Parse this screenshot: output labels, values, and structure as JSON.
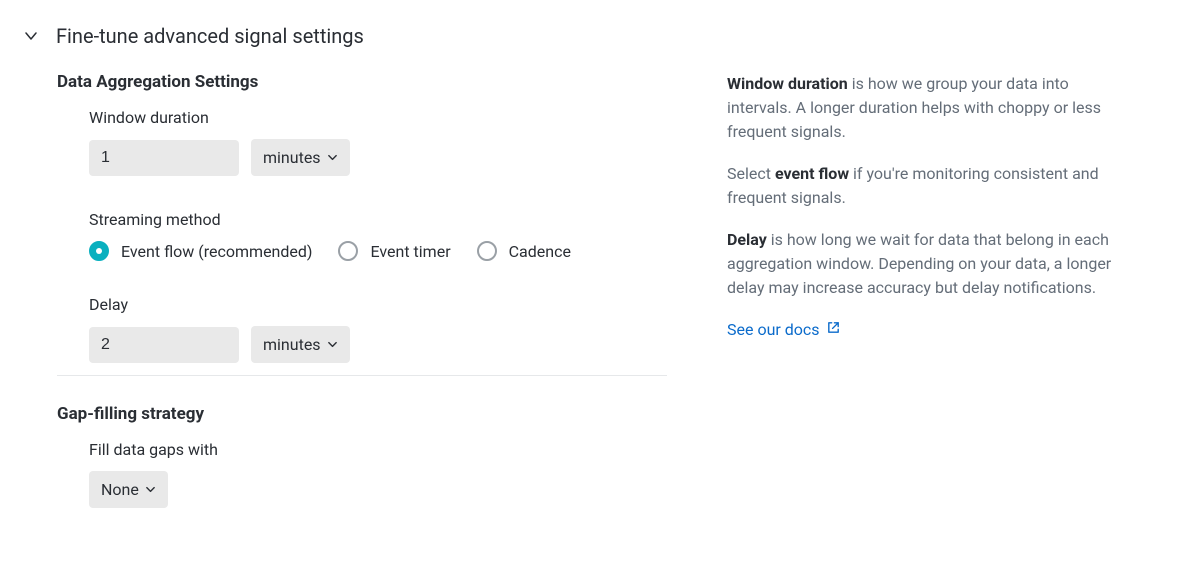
{
  "header": {
    "title": "Fine-tune advanced signal settings"
  },
  "sections": {
    "aggregation": {
      "title": "Data Aggregation Settings",
      "window_duration": {
        "label": "Window duration",
        "value": "1",
        "unit": "minutes"
      },
      "streaming": {
        "label": "Streaming method",
        "options": {
          "event_flow": "Event flow (recommended)",
          "event_timer": "Event timer",
          "cadence": "Cadence"
        },
        "selected": "event_flow"
      },
      "delay": {
        "label": "Delay",
        "value": "2",
        "unit": "minutes"
      }
    },
    "gap": {
      "title": "Gap-filling strategy",
      "fill": {
        "label": "Fill data gaps with",
        "value": "None"
      }
    }
  },
  "help": {
    "p1_bold": "Window duration",
    "p1_rest": " is how we group your data into intervals. A longer duration helps with choppy or less frequent signals.",
    "p2_pre": "Select ",
    "p2_bold": "event flow",
    "p2_rest": " if you're monitoring consistent and frequent signals.",
    "p3_bold": "Delay",
    "p3_rest": " is how long we wait for data that belong in each aggregation window. Depending on your data, a longer delay may increase accuracy but delay notifications.",
    "docs_link": "See our docs"
  }
}
